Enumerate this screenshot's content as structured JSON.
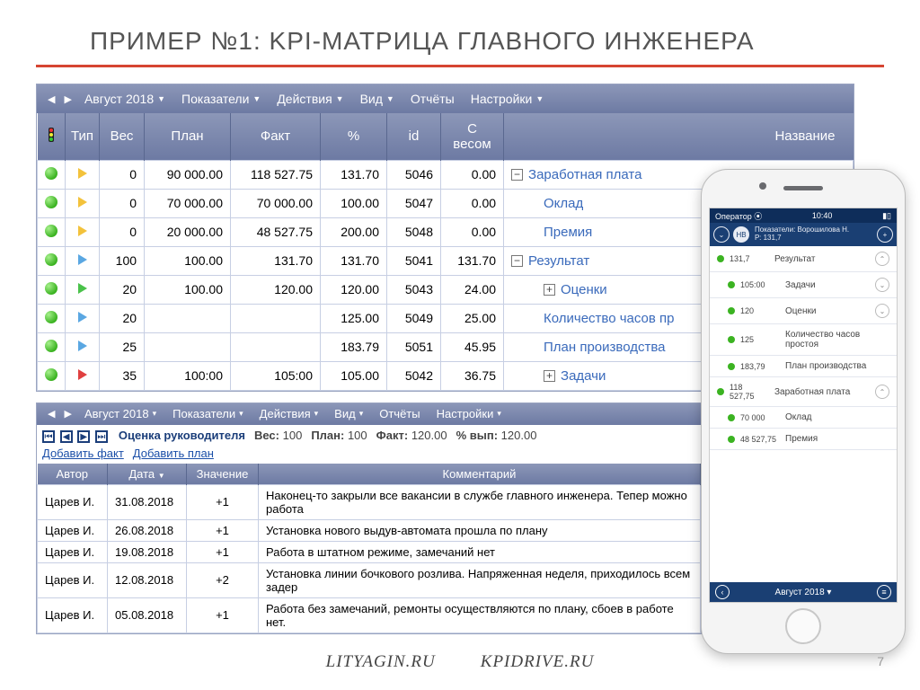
{
  "title": "ПРИМЕР №1: KPI-МАТРИЦА ГЛАВНОГО ИНЖЕНЕРА",
  "menubar1": {
    "month": "Август 2018",
    "items": [
      "Показатели",
      "Действия",
      "Вид",
      "Отчёты",
      "Настройки"
    ]
  },
  "table1": {
    "headers": {
      "type": "Тип",
      "weight": "Вес",
      "plan": "План",
      "fact": "Факт",
      "pct": "%",
      "id": "id",
      "weighted": "С весом",
      "name": "Название"
    },
    "rows": [
      {
        "tri": "y",
        "weight": "0",
        "plan": "90 000.00",
        "fact": "118 527.75",
        "pct": "131.70",
        "id": "5046",
        "weighted": "0.00",
        "exp": "−",
        "indent": 0,
        "name": "Заработная плата"
      },
      {
        "tri": "y",
        "weight": "0",
        "plan": "70 000.00",
        "fact": "70 000.00",
        "pct": "100.00",
        "id": "5047",
        "weighted": "0.00",
        "exp": "",
        "indent": 1,
        "name": "Оклад"
      },
      {
        "tri": "y",
        "weight": "0",
        "plan": "20 000.00",
        "fact": "48 527.75",
        "pct": "200.00",
        "id": "5048",
        "weighted": "0.00",
        "exp": "",
        "indent": 1,
        "name": "Премия"
      },
      {
        "tri": "b",
        "weight": "100",
        "plan": "100.00",
        "fact": "131.70",
        "pct": "131.70",
        "id": "5041",
        "weighted": "131.70",
        "exp": "−",
        "indent": 0,
        "name": "Результат"
      },
      {
        "tri": "g",
        "weight": "20",
        "plan": "100.00",
        "fact": "120.00",
        "pct": "120.00",
        "id": "5043",
        "weighted": "24.00",
        "exp": "+",
        "indent": 1,
        "name": "Оценки"
      },
      {
        "tri": "b",
        "weight": "20",
        "plan": "",
        "fact": "",
        "pct": "125.00",
        "id": "5049",
        "weighted": "25.00",
        "exp": "",
        "indent": 1,
        "name": "Количество часов пр"
      },
      {
        "tri": "b",
        "weight": "25",
        "plan": "",
        "fact": "",
        "pct": "183.79",
        "id": "5051",
        "weighted": "45.95",
        "exp": "",
        "indent": 1,
        "name": "План производства"
      },
      {
        "tri": "r",
        "weight": "35",
        "plan": "100:00",
        "fact": "105:00",
        "pct": "105.00",
        "id": "5042",
        "weighted": "36.75",
        "exp": "+",
        "indent": 1,
        "name": "Задачи"
      }
    ]
  },
  "menubar2": {
    "month": "Август 2018",
    "items": [
      "Показатели",
      "Действия",
      "Вид",
      "Отчёты",
      "Настройки"
    ]
  },
  "subtool": {
    "rating_label": "Оценка руководителя",
    "weight_label": "Вес:",
    "weight": "100",
    "plan_label": "План:",
    "plan": "100",
    "fact_label": "Факт:",
    "fact": "120.00",
    "pct_label": "% вып:",
    "pct": "120.00",
    "add_fact": "Добавить факт",
    "add_plan": "Добавить план"
  },
  "table2": {
    "headers": {
      "author": "Автор",
      "date": "Дата",
      "value": "Значение",
      "comment": "Комментарий"
    },
    "rows": [
      {
        "author": "Царев И.",
        "date": "31.08.2018",
        "value": "+1",
        "comment": "Наконец-то закрыли все вакансии в службе главного инженера. Тепер можно работа"
      },
      {
        "author": "Царев И.",
        "date": "26.08.2018",
        "value": "+1",
        "comment": "Установка нового выдув-автомата прошла по плану"
      },
      {
        "author": "Царев И.",
        "date": "19.08.2018",
        "value": "+1",
        "comment": "Работа в штатном режиме, замечаний нет"
      },
      {
        "author": "Царев И.",
        "date": "12.08.2018",
        "value": "+2",
        "comment": "Установка линии бочкового розлива. Напряженная неделя, приходилось всем задер"
      },
      {
        "author": "Царев И.",
        "date": "05.08.2018",
        "value": "+1",
        "comment": "Работа без замечаний, ремонты осуществляются по плану, сбоев в работе нет."
      }
    ]
  },
  "phone": {
    "carrier": "Оператор",
    "time": "10:40",
    "avatar": "НВ",
    "head1": "Показатели: Ворошилова Н.",
    "head2": "Р: 131,7",
    "rows": [
      {
        "val": "131,7",
        "label": "Результат",
        "chev": "up",
        "indent": 0
      },
      {
        "val": "105:00",
        "label": "Задачи",
        "chev": "down",
        "indent": 1
      },
      {
        "val": "120",
        "label": "Оценки",
        "chev": "down",
        "indent": 1
      },
      {
        "val": "125",
        "label": "Количество часов простоя",
        "chev": "",
        "indent": 1
      },
      {
        "val": "183,79",
        "label": "План производства",
        "chev": "",
        "indent": 1
      },
      {
        "val": "118 527,75",
        "label": "Заработная плата",
        "chev": "up",
        "indent": 0
      },
      {
        "val": "70 000",
        "label": "Оклад",
        "chev": "",
        "indent": 1
      },
      {
        "val": "48 527,75",
        "label": "Премия",
        "chev": "",
        "indent": 1
      }
    ],
    "footer": "Август 2018"
  },
  "footer": {
    "left": "LITYAGIN.RU",
    "right": "KPIDRIVE.RU"
  },
  "page_number": "7"
}
